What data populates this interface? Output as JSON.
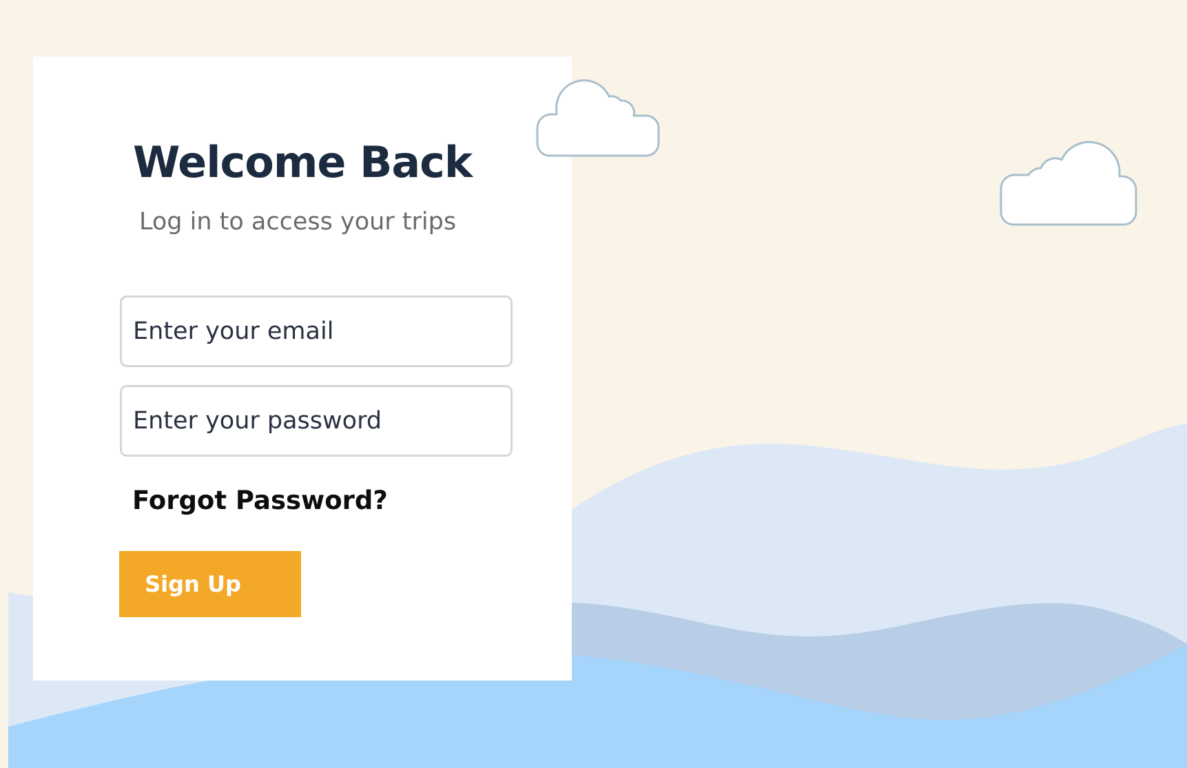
{
  "login": {
    "title": "Welcome Back",
    "subtitle": "Log in to access your trips",
    "email_placeholder": "Enter your email",
    "password_placeholder": "Enter your password",
    "forgot_label": "Forgot Password?",
    "submit_label": "Sign Up"
  },
  "colors": {
    "background": "#f9f3e8",
    "card": "#ffffff",
    "title_text": "#1c2b3f",
    "subtitle_text": "#6b6b6b",
    "field_border": "#d6d6da",
    "button_bg": "#f4a827",
    "button_text": "#ffffff",
    "wave_light": "#dce8f6",
    "wave_mid": "#b8cde6",
    "wave_front": "#a6d5fc",
    "cloud_outline": "#a9bfcc"
  },
  "decor": {
    "cloud_icons": [
      "cloud-icon",
      "cloud-icon"
    ]
  }
}
